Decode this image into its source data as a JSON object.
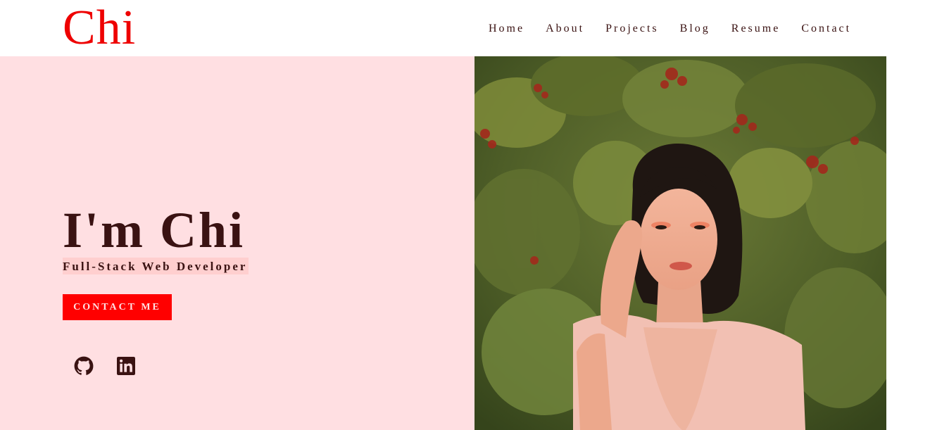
{
  "site": {
    "logo": "Chi"
  },
  "nav": {
    "items": [
      {
        "label": "Home"
      },
      {
        "label": "About"
      },
      {
        "label": "Projects"
      },
      {
        "label": "Blog"
      },
      {
        "label": "Resume"
      },
      {
        "label": "Contact"
      }
    ]
  },
  "hero": {
    "title": "I'm Chi",
    "subtitle": "Full-Stack Web Developer",
    "cta_label": "CONTACT ME",
    "social": [
      {
        "icon": "github-icon"
      },
      {
        "icon": "linkedin-icon"
      }
    ],
    "photo_alt": "Portrait of Chi in front of green foliage with red berries"
  },
  "colors": {
    "accent": "#ff0000",
    "text_dark": "#3a1212",
    "hero_bg": "#ffdfe2",
    "highlight": "#ffcfcf"
  }
}
